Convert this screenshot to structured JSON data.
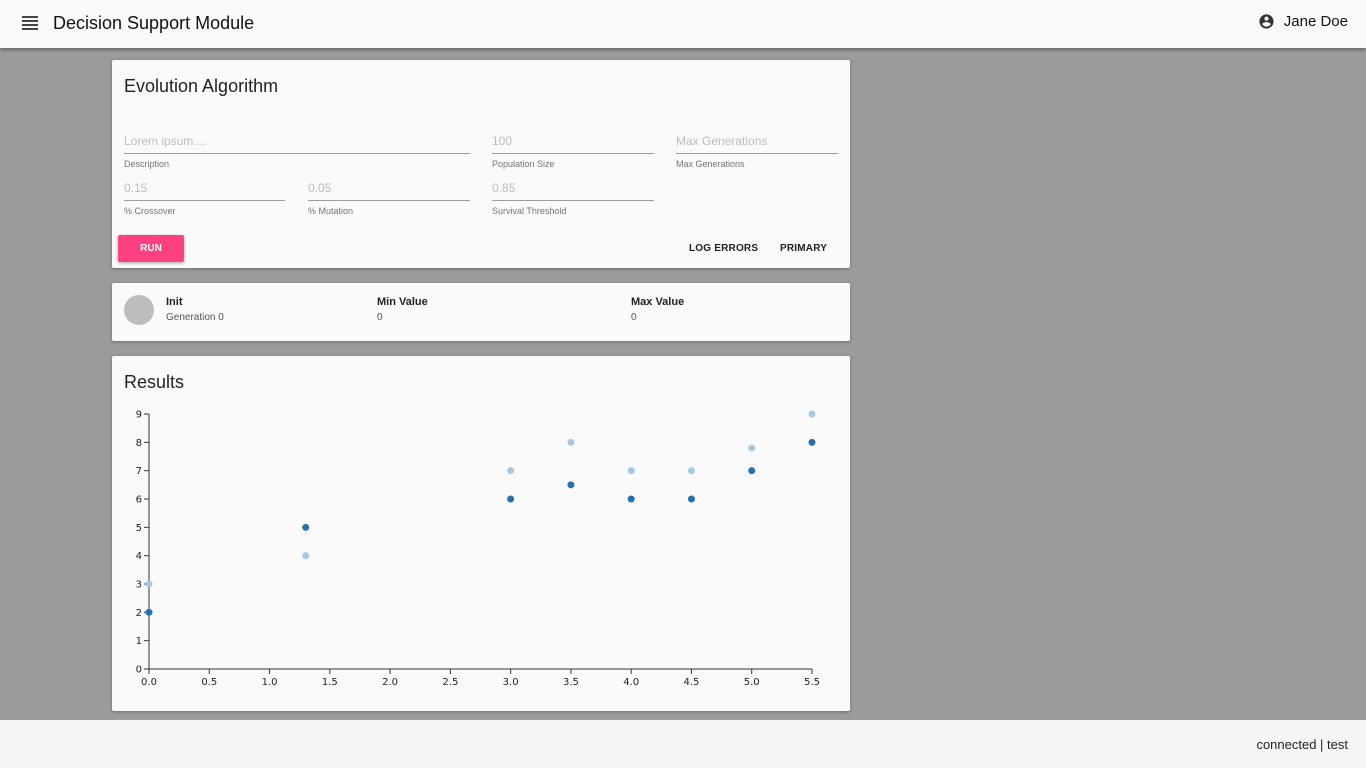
{
  "header": {
    "title": "Decision Support Module",
    "user_name": "Jane Doe"
  },
  "form": {
    "title": "Evolution Algorithm",
    "fields": {
      "description": {
        "value": "Lorem ipsum....",
        "label": "Description"
      },
      "population_size": {
        "value": "100",
        "label": "Population Size"
      },
      "max_generations": {
        "value": "Max Generations",
        "label": "Max Generations"
      },
      "crossover": {
        "value": "0.15",
        "label": "% Crossover"
      },
      "mutation": {
        "value": "0.05",
        "label": "% Mutation"
      },
      "survival_threshold": {
        "value": "0.85",
        "label": "Survival Threshold"
      }
    },
    "buttons": {
      "run": "RUN",
      "log_errors": "LOG ERRORS",
      "primary": "PRIMARY"
    },
    "accent_color": "#ff4081"
  },
  "status": {
    "state": "Init",
    "generation": "Generation 0",
    "min_label": "Min Value",
    "min_value": "0",
    "max_label": "Max Value",
    "max_value": "0"
  },
  "results": {
    "title": "Results"
  },
  "chart_data": {
    "type": "scatter",
    "xlim": [
      0,
      5.5
    ],
    "ylim": [
      0,
      9
    ],
    "x_ticks": [
      "0.0",
      "0.5",
      "1.0",
      "1.5",
      "2.0",
      "2.5",
      "3.0",
      "3.5",
      "4.0",
      "4.5",
      "5.0",
      "5.5"
    ],
    "y_ticks": [
      "0",
      "1",
      "2",
      "3",
      "4",
      "5",
      "6",
      "7",
      "8",
      "9"
    ],
    "grid": false,
    "series": [
      {
        "color": "#a6c8e8",
        "points": [
          [
            0,
            3
          ],
          [
            1.3,
            4
          ],
          [
            3.0,
            7
          ],
          [
            3.5,
            8
          ],
          [
            4.0,
            7
          ],
          [
            4.5,
            7
          ],
          [
            5.0,
            7.8
          ],
          [
            5.5,
            9
          ]
        ]
      },
      {
        "color": "#2171b5",
        "points": [
          [
            0,
            2
          ],
          [
            1.3,
            5
          ],
          [
            3.0,
            6
          ],
          [
            3.5,
            6.5
          ],
          [
            4.0,
            6
          ],
          [
            4.5,
            6
          ],
          [
            5.0,
            7
          ],
          [
            5.5,
            8
          ]
        ]
      }
    ]
  },
  "footer": {
    "status": "connected | test"
  }
}
